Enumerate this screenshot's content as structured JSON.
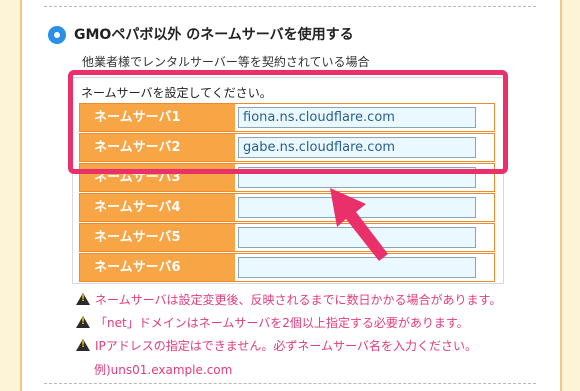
{
  "option": {
    "label": "GMOペパボ以外 のネームサーバを使用する",
    "selected": true
  },
  "description": "他業者様でレンタルサーバー等を契約されている場合",
  "instruction": "ネームサーバを設定してください。",
  "nameservers": [
    {
      "label": "ネームサーバ1",
      "value": "fiona.ns.cloudflare.com"
    },
    {
      "label": "ネームサーバ2",
      "value": "gabe.ns.cloudflare.com"
    },
    {
      "label": "ネームサーバ3",
      "value": ""
    },
    {
      "label": "ネームサーバ4",
      "value": ""
    },
    {
      "label": "ネームサーバ5",
      "value": ""
    },
    {
      "label": "ネームサーバ6",
      "value": ""
    }
  ],
  "warnings": [
    "ネームサーバは設定変更後、反映されるまでに数日かかる場合があります。",
    "「net」ドメインはネームサーバを2個以上指定する必要があります。",
    "IPアドレスの指定はできません。必ずネームサーバ名を入力ください。"
  ],
  "example": "例)uns01.example.com",
  "colors": {
    "highlight": "#e9306b",
    "label_bg": "#f7a545",
    "warning_text": "#e23c7d"
  }
}
